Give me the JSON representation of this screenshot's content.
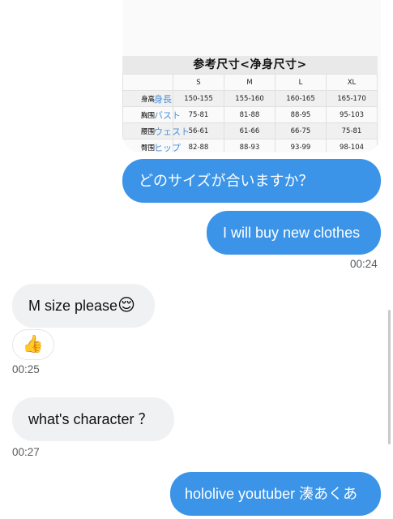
{
  "size_chart": {
    "title": "参考尺寸<净身尺寸>",
    "columns": [
      "",
      "S",
      "M",
      "L",
      "XL"
    ],
    "rows": [
      {
        "label": "身高",
        "overlay": "身長",
        "values": [
          "150-155",
          "155-160",
          "160-165",
          "165-170"
        ]
      },
      {
        "label": "胸围",
        "overlay": "バスト",
        "values": [
          "75-81",
          "81-88",
          "88-95",
          "95-103"
        ]
      },
      {
        "label": "腰围",
        "overlay": "ウェスト",
        "values": [
          "56-61",
          "61-66",
          "66-75",
          "75-81"
        ]
      },
      {
        "label": "臀围",
        "overlay": "ヒップ",
        "values": [
          "82-88",
          "88-93",
          "93-99",
          "98-104"
        ]
      }
    ]
  },
  "messages": {
    "m1": {
      "text": "どのサイズが合いますか？"
    },
    "m2": {
      "text": "I will buy new clothes",
      "time": "00:24"
    },
    "m3": {
      "text": "M size please",
      "emoji": "😌",
      "time": "00:25"
    },
    "reaction": {
      "emoji": "👍"
    },
    "m4": {
      "text": "what's character ？",
      "time": "00:27"
    },
    "m5": {
      "text": "hololive youtuber 湊あくあ"
    }
  },
  "colors": {
    "outgoing_bubble": "#3b94e8",
    "incoming_bubble": "#eff1f3",
    "overlay_text": "#4a90d9"
  }
}
